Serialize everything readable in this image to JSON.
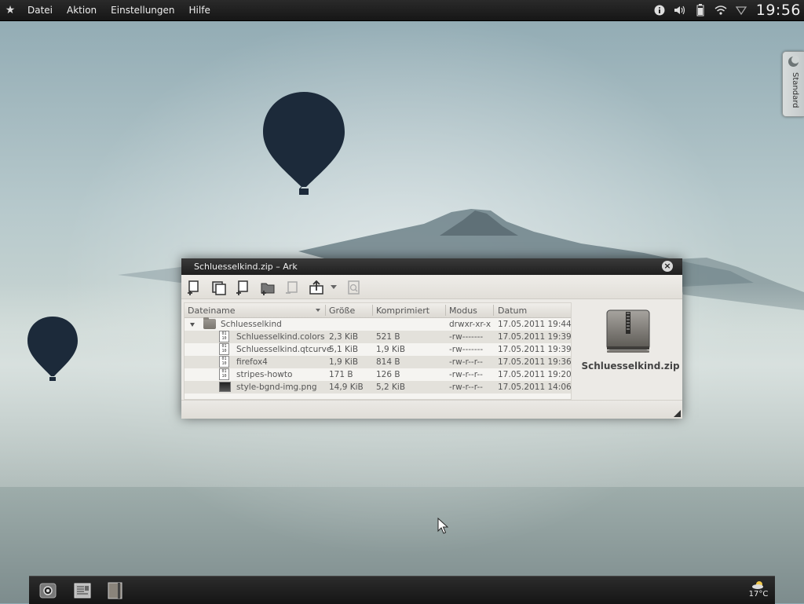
{
  "top_panel": {
    "menu": [
      {
        "id": "datei",
        "label": "Datei"
      },
      {
        "id": "aktion",
        "label": "Aktion"
      },
      {
        "id": "einstellungen",
        "label": "Einstellungen"
      },
      {
        "id": "hilfe",
        "label": "Hilfe"
      }
    ],
    "tray_icons": [
      "info-icon",
      "volume-icon",
      "battery-icon",
      "wifi-icon",
      "shield-icon"
    ],
    "clock": "19:56"
  },
  "activity_tab": {
    "label": "Standard"
  },
  "window": {
    "title": "Schluesselkind.zip – Ark",
    "columns": {
      "name": "Dateiname",
      "size": "Größe",
      "compressed": "Komprimiert",
      "mode": "Modus",
      "date": "Datum"
    },
    "folder": {
      "name": "Schluesselkind",
      "size": "",
      "compressed": "",
      "mode": "drwxr-xr-x",
      "date": "17.05.2011 19:44"
    },
    "files": [
      {
        "name": "Schluesselkind.colors",
        "size": "2,3 KiB",
        "compressed": "521 B",
        "mode": "-rw-------",
        "date": "17.05.2011 19:39",
        "icon": "binary-file-icon"
      },
      {
        "name": "Schluesselkind.qtcurve",
        "size": "5,1 KiB",
        "compressed": "1,9 KiB",
        "mode": "-rw-------",
        "date": "17.05.2011 19:39",
        "icon": "binary-file-icon"
      },
      {
        "name": "firefox4",
        "size": "1,9 KiB",
        "compressed": "814 B",
        "mode": "-rw-r--r--",
        "date": "17.05.2011 19:36",
        "icon": "binary-file-icon"
      },
      {
        "name": "stripes-howto",
        "size": "171 B",
        "compressed": "126 B",
        "mode": "-rw-r--r--",
        "date": "17.05.2011 19:20",
        "icon": "binary-file-icon"
      },
      {
        "name": "style-bgnd-img.png",
        "size": "14,9 KiB",
        "compressed": "5,2 KiB",
        "mode": "-rw-r--r--",
        "date": "17.05.2011 14:06",
        "icon": "image-file-icon"
      }
    ],
    "preview": {
      "filename": "Schluesselkind.zip"
    }
  },
  "bottom_panel": {
    "tasks": [
      "task-eye-icon",
      "task-document-icon",
      "task-book-icon"
    ],
    "weather": {
      "temp": "17°C"
    }
  },
  "colors": {
    "panel": "#1e1e1e",
    "window_bg": "#eceae6",
    "row_alt": "#e3e1db",
    "balloon": "#1c2a3a"
  }
}
